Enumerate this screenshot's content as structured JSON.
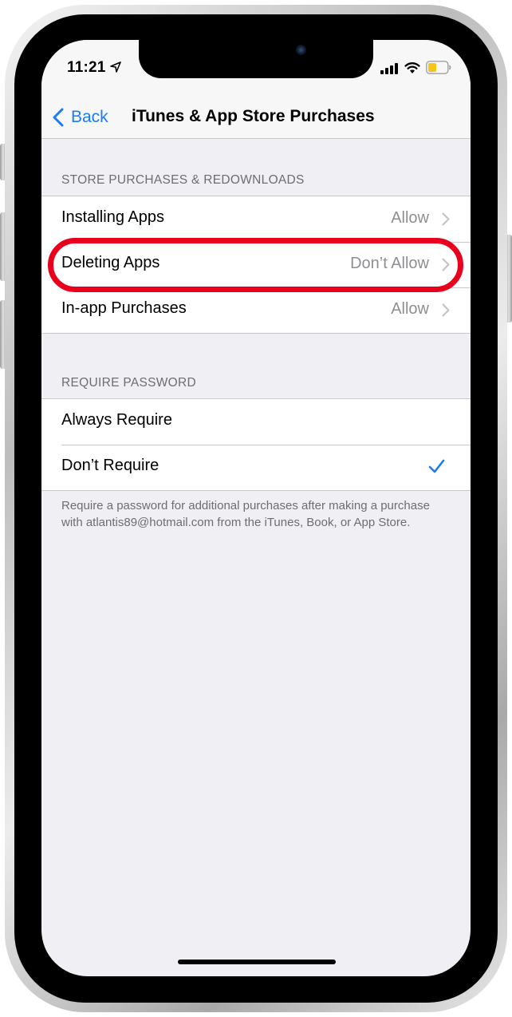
{
  "status_bar": {
    "time": "11:21"
  },
  "nav": {
    "back_label": "Back",
    "title": "iTunes & App Store Purchases"
  },
  "section_store": {
    "header": "STORE PURCHASES & REDOWNLOADS",
    "rows": [
      {
        "label": "Installing Apps",
        "value": "Allow"
      },
      {
        "label": "Deleting Apps",
        "value": "Don’t Allow"
      },
      {
        "label": "In-app Purchases",
        "value": "Allow"
      }
    ]
  },
  "section_password": {
    "header": "REQUIRE PASSWORD",
    "rows": [
      {
        "label": "Always Require",
        "selected": false
      },
      {
        "label": "Don’t Require",
        "selected": true
      }
    ],
    "footer": "Require a password for additional purchases after making a purchase with atlantis89@hotmail.com from the iTunes, Book, or App Store."
  },
  "colors": {
    "accent": "#1a7cf3",
    "highlight": "#e8001c",
    "battery": "#f5c518"
  }
}
